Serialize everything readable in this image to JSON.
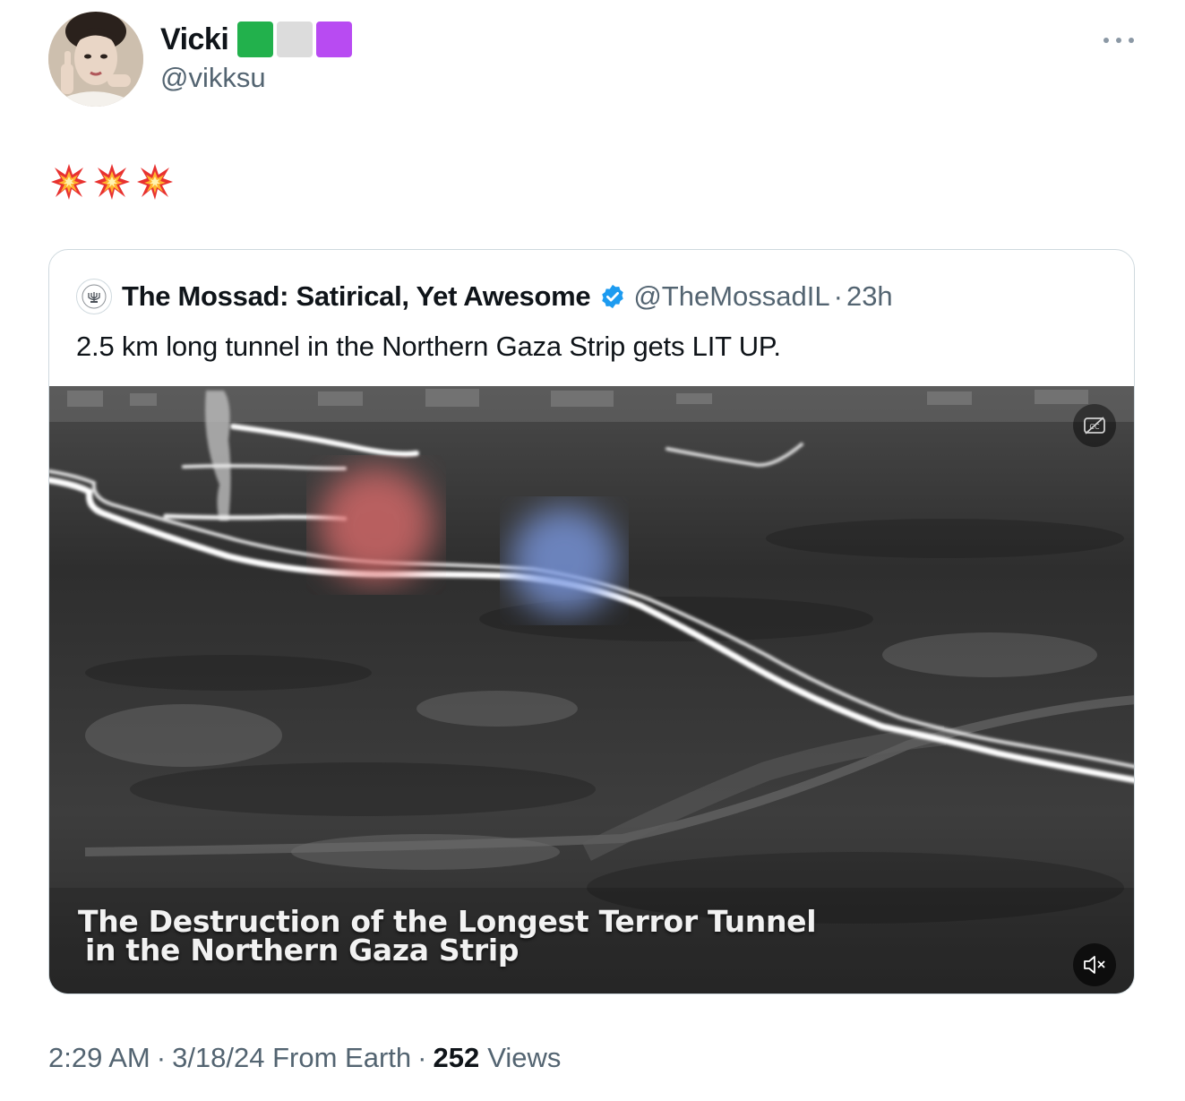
{
  "author": {
    "display_name": "Vicki",
    "handle": "@vikksu",
    "badge_colors": [
      "#22b14c",
      "#dcdcdc",
      "#b84bf2"
    ]
  },
  "tweet": {
    "emojis": [
      "collision",
      "collision",
      "collision"
    ]
  },
  "quoted_tweet": {
    "display_name": "The Mossad: Satirical, Yet Awesome",
    "handle": "@TheMossadIL",
    "separator": "·",
    "time": "23h",
    "text": "2.5 km long tunnel in the Northern Gaza Strip gets LIT UP.",
    "video_caption_line1": "The Destruction of the Longest Terror Tunnel",
    "video_caption_line2": "in the Northern Gaza Strip"
  },
  "footer": {
    "time": "2:29 AM",
    "separator": "·",
    "date_source": "3/18/24 From Earth",
    "views_count": "252",
    "views_label": "Views"
  },
  "colors": {
    "text_primary": "#0f1419",
    "text_secondary": "#536471",
    "border": "#cfd9de",
    "verified_blue": "#1d9bf0"
  }
}
